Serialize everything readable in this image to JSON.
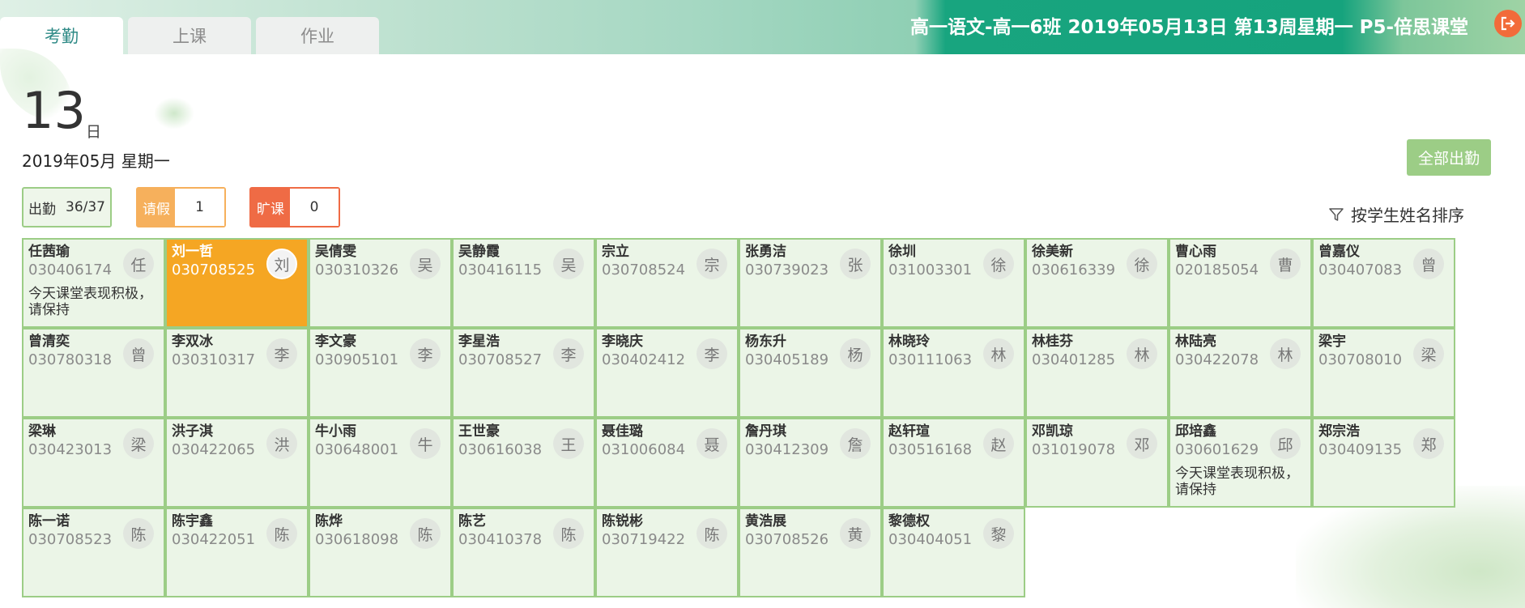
{
  "tabs": [
    {
      "label": "考勤",
      "active": true
    },
    {
      "label": "上课",
      "active": false
    },
    {
      "label": "作业",
      "active": false
    }
  ],
  "header": {
    "title": "高一语文-高一6班 2019年05月13日 第13周星期一 P5-倍思课堂"
  },
  "date": {
    "day": "13",
    "unit": "日",
    "line": "2019年05月 星期一"
  },
  "actions": {
    "all_attend": "全部出勤",
    "sort": "按学生姓名排序"
  },
  "counters": {
    "present": {
      "label": "出勤",
      "value": "36/37"
    },
    "leave": {
      "label": "请假",
      "value": "1"
    },
    "absent": {
      "label": "旷课",
      "value": "0"
    }
  },
  "students": [
    {
      "name": "任茜瑜",
      "id": "030406174",
      "avatar": "任",
      "note": "今天课堂表现积极，请保持"
    },
    {
      "name": "刘一哲",
      "id": "030708525",
      "avatar": "刘",
      "status": "leave"
    },
    {
      "name": "吴倩雯",
      "id": "030310326",
      "avatar": "吴"
    },
    {
      "name": "吴静霞",
      "id": "030416115",
      "avatar": "吴"
    },
    {
      "name": "宗立",
      "id": "030708524",
      "avatar": "宗"
    },
    {
      "name": "张勇洁",
      "id": "030739023",
      "avatar": "张"
    },
    {
      "name": "徐圳",
      "id": "031003301",
      "avatar": "徐"
    },
    {
      "name": "徐美新",
      "id": "030616339",
      "avatar": "徐"
    },
    {
      "name": "曹心雨",
      "id": "020185054",
      "avatar": "曹"
    },
    {
      "name": "曾嘉仪",
      "id": "030407083",
      "avatar": "曾"
    },
    {
      "name": "曾清奕",
      "id": "030780318",
      "avatar": "曾"
    },
    {
      "name": "李双冰",
      "id": "030310317",
      "avatar": "李"
    },
    {
      "name": "李文豪",
      "id": "030905101",
      "avatar": "李"
    },
    {
      "name": "李星浩",
      "id": "030708527",
      "avatar": "李"
    },
    {
      "name": "李晓庆",
      "id": "030402412",
      "avatar": "李"
    },
    {
      "name": "杨东升",
      "id": "030405189",
      "avatar": "杨"
    },
    {
      "name": "林晓玲",
      "id": "030111063",
      "avatar": "林"
    },
    {
      "name": "林桂芬",
      "id": "030401285",
      "avatar": "林"
    },
    {
      "name": "林陆亮",
      "id": "030422078",
      "avatar": "林"
    },
    {
      "name": "梁宇",
      "id": "030708010",
      "avatar": "梁"
    },
    {
      "name": "梁琳",
      "id": "030423013",
      "avatar": "梁"
    },
    {
      "name": "洪子淇",
      "id": "030422065",
      "avatar": "洪"
    },
    {
      "name": "牛小雨",
      "id": "030648001",
      "avatar": "牛"
    },
    {
      "name": "王世豪",
      "id": "030616038",
      "avatar": "王"
    },
    {
      "name": "聂佳璐",
      "id": "031006084",
      "avatar": "聂"
    },
    {
      "name": "詹丹琪",
      "id": "030412309",
      "avatar": "詹"
    },
    {
      "name": "赵轩瑄",
      "id": "030516168",
      "avatar": "赵"
    },
    {
      "name": "邓凯琼",
      "id": "031019078",
      "avatar": "邓"
    },
    {
      "name": "邱培鑫",
      "id": "030601629",
      "avatar": "邱",
      "note": "今天课堂表现积极，请保持"
    },
    {
      "name": "郑宗浩",
      "id": "030409135",
      "avatar": "郑"
    },
    {
      "name": "陈一诺",
      "id": "030708523",
      "avatar": "陈"
    },
    {
      "name": "陈宇鑫",
      "id": "030422051",
      "avatar": "陈"
    },
    {
      "name": "陈烨",
      "id": "030618098",
      "avatar": "陈"
    },
    {
      "name": "陈艺",
      "id": "030410378",
      "avatar": "陈"
    },
    {
      "name": "陈锐彬",
      "id": "030719422",
      "avatar": "陈"
    },
    {
      "name": "黄浩展",
      "id": "030708526",
      "avatar": "黄"
    },
    {
      "name": "黎德权",
      "id": "030404051",
      "avatar": "黎"
    }
  ]
}
